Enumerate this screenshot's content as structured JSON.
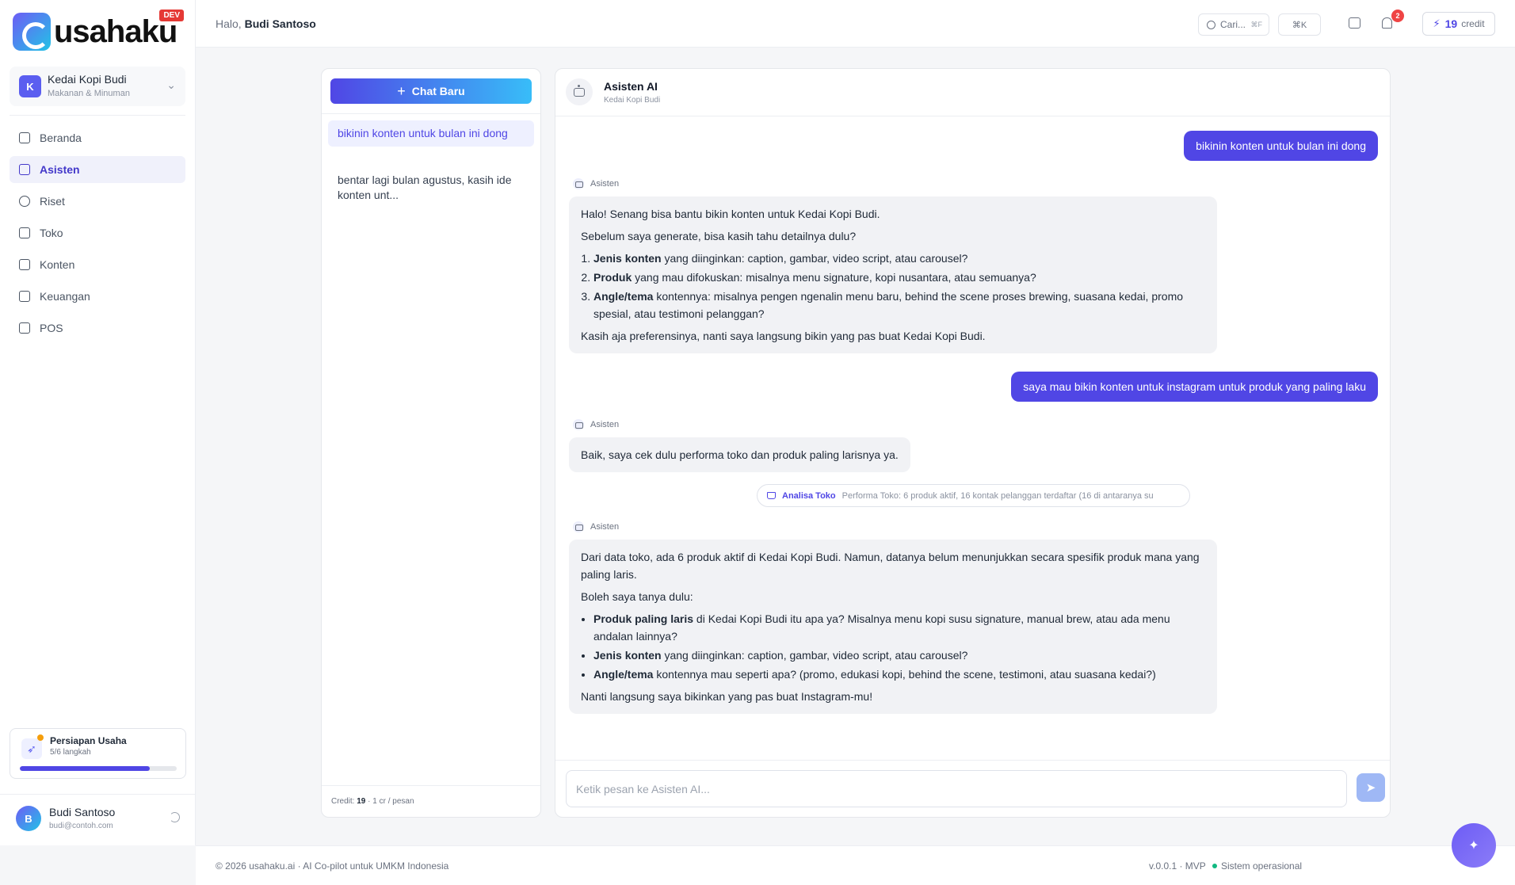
{
  "brand": {
    "logo_text": "usahaku",
    "env_badge": "DEV"
  },
  "business": {
    "initial": "K",
    "name": "Kedai Kopi Budi",
    "category": "Makanan & Minuman"
  },
  "sidebar": {
    "items": [
      {
        "label": "Beranda",
        "icon": "grid-icon",
        "active": false
      },
      {
        "label": "Asisten",
        "icon": "robot-icon",
        "active": true
      },
      {
        "label": "Riset",
        "icon": "search-icon",
        "active": false
      },
      {
        "label": "Toko",
        "icon": "cart-icon",
        "active": false
      },
      {
        "label": "Konten",
        "icon": "document-icon",
        "active": false
      },
      {
        "label": "Keuangan",
        "icon": "wallet-icon",
        "active": false
      },
      {
        "label": "POS",
        "icon": "cart-icon",
        "active": false
      }
    ]
  },
  "setup": {
    "title": "Persiapan Usaha",
    "steps": "5/6 langkah",
    "progress": 0.83
  },
  "user": {
    "initial": "B",
    "name": "Budi Santoso",
    "email": "budi@contoh.com"
  },
  "topbar": {
    "greeting_prefix": "Halo,",
    "greeting_name": "Budi Santoso",
    "search_label": "Cari...",
    "search_kbd": "⌘F",
    "command_kbd": "⌘K",
    "notification_count": "2",
    "credit_value": "19",
    "credit_label": "credit"
  },
  "chat_list": {
    "new_chat_label": "Chat Baru",
    "conversations": [
      {
        "title": "bikinin konten untuk bulan ini dong",
        "active": true
      },
      {
        "title": "bentar lagi bulan agustus, kasih ide konten unt...",
        "active": false
      }
    ],
    "footer_prefix": "Credit:",
    "footer_credit": "19",
    "footer_suffix": "· 1 cr / pesan"
  },
  "chat": {
    "title": "Asisten AI",
    "subtitle": "Kedai Kopi Budi",
    "assistant_label": "Asisten",
    "user_msg_1": "bikinin konten untuk bulan ini dong",
    "bot_msg_1": {
      "p1": "Halo! Senang bisa bantu bikin konten untuk Kedai Kopi Budi.",
      "p2": "Sebelum saya generate, bisa kasih tahu detailnya dulu?",
      "items": [
        {
          "bold": "Jenis konten",
          "text": " yang diinginkan: caption, gambar, video script, atau carousel?"
        },
        {
          "bold": "Produk",
          "text": " yang mau difokuskan: misalnya menu signature, kopi nusantara, atau semuanya?"
        },
        {
          "bold": "Angle/tema",
          "text": " kontennya: misalnya pengen ngenalin menu baru, behind the scene proses brewing, suasana kedai, promo spesial, atau testimoni pelanggan?"
        }
      ],
      "p3": "Kasih aja preferensinya, nanti saya langsung bikin yang pas buat Kedai Kopi Budi."
    },
    "user_msg_2": "saya mau bikin konten untuk instagram untuk produk yang paling laku",
    "bot_msg_2": "Baik, saya cek dulu performa toko dan produk paling larisnya ya.",
    "tool": {
      "name": "Analisa Toko",
      "description": "Performa Toko: 6 produk aktif, 16 kontak pelanggan terdaftar (16 di antaranya su"
    },
    "bot_msg_3": {
      "p1": "Dari data toko, ada 6 produk aktif di Kedai Kopi Budi. Namun, datanya belum menunjukkan secara spesifik produk mana yang paling laris.",
      "p2": "Boleh saya tanya dulu:",
      "items": [
        {
          "bold": "Produk paling laris",
          "text": " di Kedai Kopi Budi itu apa ya? Misalnya menu kopi susu signature, manual brew, atau ada menu andalan lainnya?"
        },
        {
          "bold": "Jenis konten",
          "text": " yang diinginkan: caption, gambar, video script, atau carousel?"
        },
        {
          "bold": "Angle/tema",
          "text": " kontennya mau seperti apa? (promo, edukasi kopi, behind the scene, testimoni, atau suasana kedai?)"
        }
      ],
      "p3": "Nanti langsung saya bikinkan yang pas buat Instagram-mu!"
    },
    "input_placeholder": "Ketik pesan ke Asisten AI..."
  },
  "footer": {
    "copyright": "© 2026 usahaku.ai · AI Co-pilot untuk UMKM Indonesia",
    "version": "v.0.0.1 · MVP",
    "status": "Sistem operasional"
  },
  "colors": {
    "accent": "#5046e5",
    "status_ok": "#10b981",
    "badge_red": "#ef4444"
  }
}
